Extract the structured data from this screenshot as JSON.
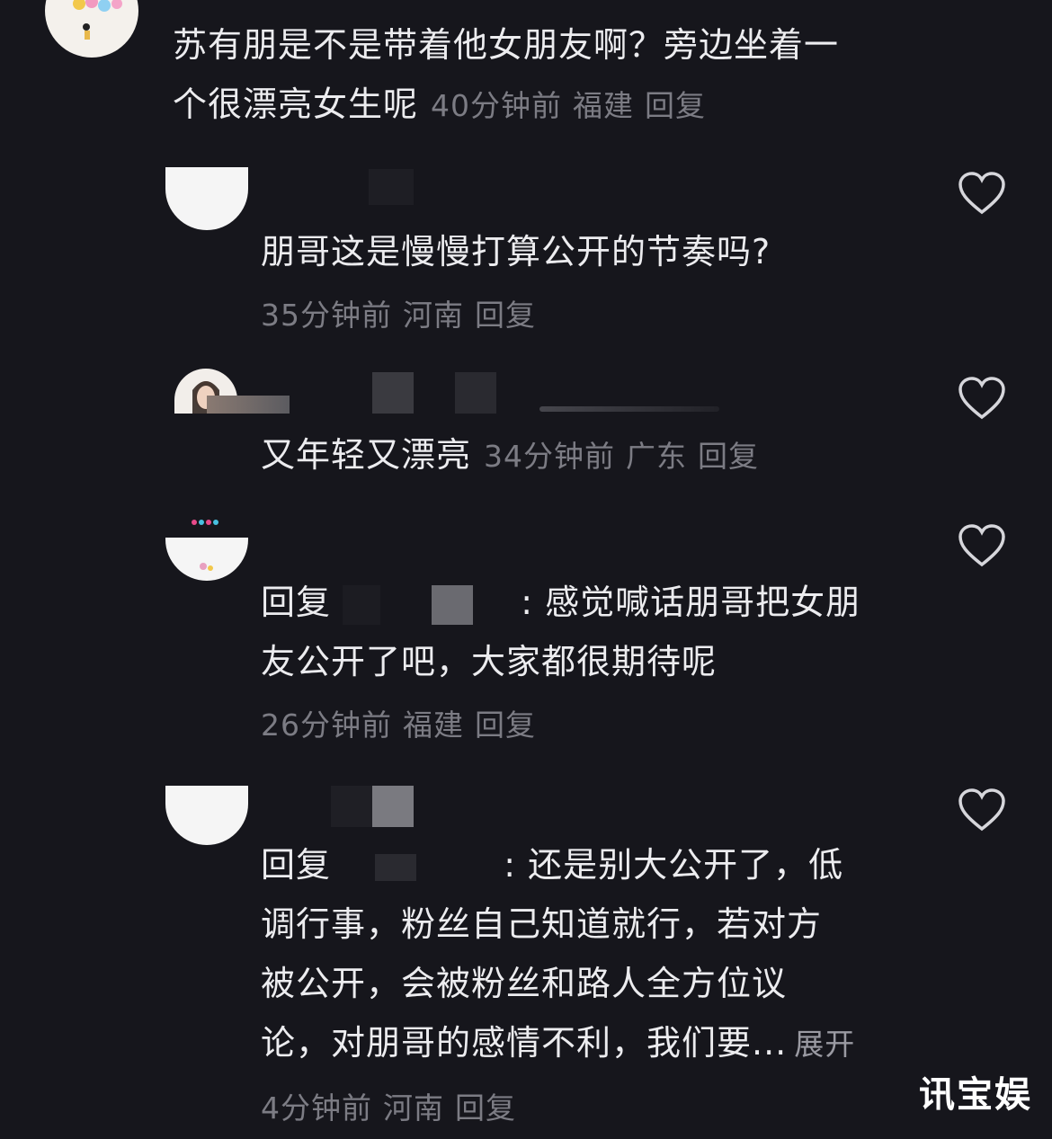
{
  "comments": [
    {
      "line1": "苏有朋是不是带着他女朋友啊？旁边坐着一",
      "line2": "个很漂亮女生呢",
      "time": "40分钟前",
      "location": "福建",
      "reply": "回复"
    },
    {
      "line1": "朋哥这是慢慢打算公开的节奏吗?",
      "time": "35分钟前",
      "location": "河南",
      "reply": "回复"
    },
    {
      "line1": "又年轻又漂亮",
      "time": "34分钟前",
      "location": "广东",
      "reply": "回复"
    },
    {
      "reply_prefix": "回复",
      "line1_rest": ": 感觉喊话朋哥把女朋",
      "line2": "友公开了吧，大家都很期待呢",
      "time": "26分钟前",
      "location": "福建",
      "reply": "回复"
    },
    {
      "reply_prefix": "回复",
      "line1_rest": ": 还是别大公开了，低",
      "line2": "调行事，粉丝自己知道就行，若对方",
      "line3": "被公开，会被粉丝和路人全方位议",
      "line4": "论，对朋哥的感情不利，我们要...",
      "expand": "展开",
      "time": "4分钟前",
      "location": "河南",
      "reply": "回复"
    }
  ],
  "watermark": "讯宝娱",
  "icons": {
    "like": "heart-outline-icon"
  },
  "colors": {
    "background": "#16161c",
    "text": "#ececef",
    "meta": "#7c7c84"
  }
}
